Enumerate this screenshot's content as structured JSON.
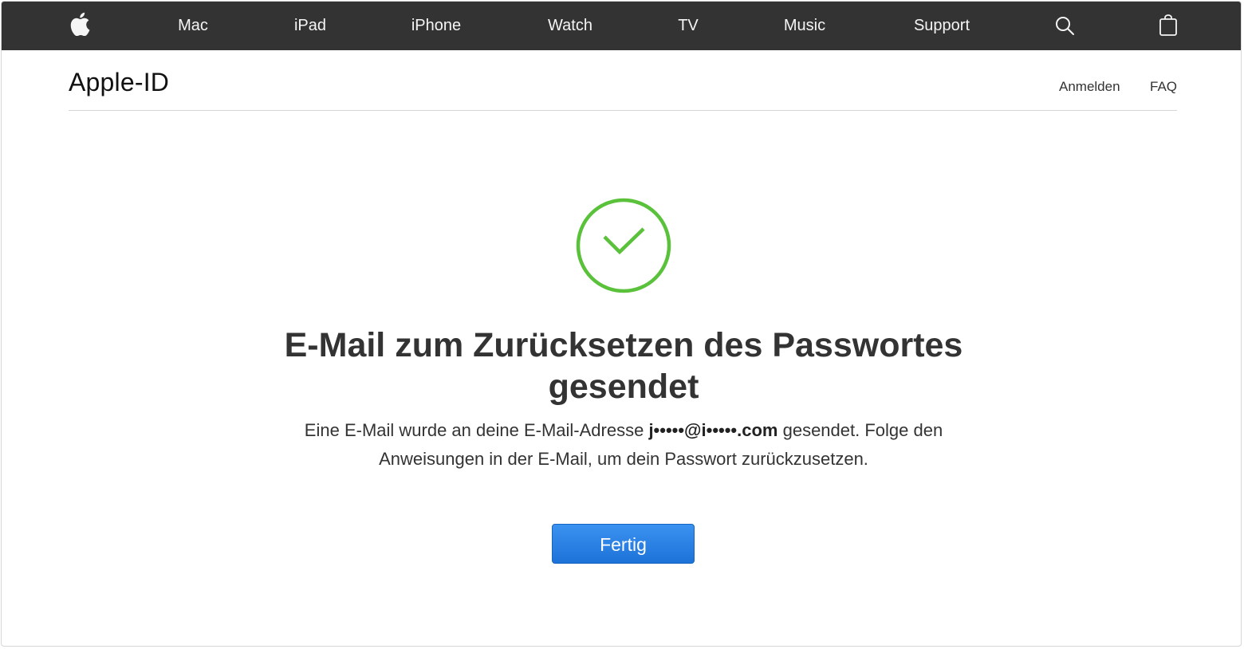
{
  "globalnav": {
    "logo_icon": "apple-logo-icon",
    "items": [
      {
        "label": "Mac"
      },
      {
        "label": "iPad"
      },
      {
        "label": "iPhone"
      },
      {
        "label": "Watch"
      },
      {
        "label": "TV"
      },
      {
        "label": "Music"
      },
      {
        "label": "Support"
      }
    ],
    "search_icon": "search-icon",
    "bag_icon": "shopping-bag-icon"
  },
  "subnav": {
    "title": "Apple-ID",
    "links": [
      {
        "label": "Anmelden"
      },
      {
        "label": "FAQ"
      }
    ]
  },
  "main": {
    "status_icon": "checkmark-circle-icon",
    "status_color": "#5ac13a",
    "headline_line1": "E-Mail zum Zurücksetzen des Passwortes",
    "headline_line2": "gesendet",
    "message_before": "Eine E-Mail wurde an deine E-Mail-Adresse ",
    "email_masked": "j•••••@i•••••.com",
    "message_after_line1": " gesendet. Folge den",
    "message_line2": "Anweisungen in der E-Mail, um dein Passwort zurückzusetzen.",
    "done_button_label": "Fertig",
    "button_color": "#2a82e4"
  }
}
